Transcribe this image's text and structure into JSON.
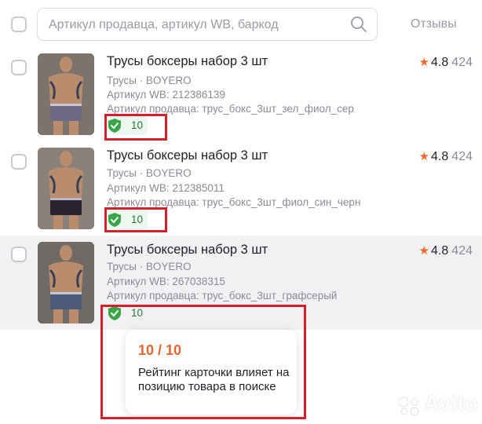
{
  "header": {
    "search_placeholder": "Артикул продавца, артикул WB, баркод",
    "reviews_column": "Отзывы"
  },
  "products": [
    {
      "title": "Трусы боксеры набор 3 шт",
      "category_brand": "Трусы · BOYERO",
      "wb_article": "Артикул WB: 212386139",
      "seller_article": "Артикул продавца: трус_бокс_3шт_зел_фиол_сер",
      "card_score": "10",
      "rating": "4.8",
      "reviews": "424",
      "shorts_color": "#6e6a86"
    },
    {
      "title": "Трусы боксеры набор 3 шт",
      "category_brand": "Трусы · BOYERO",
      "wb_article": "Артикул WB: 212385011",
      "seller_article": "Артикул продавца: трус_бокс_3шт_фиол_син_черн",
      "card_score": "10",
      "rating": "4.8",
      "reviews": "424",
      "shorts_color": "#2a2430"
    },
    {
      "title": "Трусы боксеры набор 3 шт",
      "category_brand": "Трусы · BOYERO",
      "wb_article": "Артикул WB: 267038315",
      "seller_article": "Артикул продавца: трус_бокс_3шт_графсерый",
      "card_score": "10",
      "rating": "4.8",
      "reviews": "424",
      "shorts_color": "#4a5a78"
    }
  ],
  "tooltip": {
    "score": "10 / 10",
    "text": "Рейтинг карточки влияет на позицию товара в поиске"
  },
  "watermark": "Avito",
  "colors": {
    "accent_orange": "#e0672f",
    "star": "#f16b26",
    "score_green": "#2c7a35",
    "highlight_red": "#d4202a"
  }
}
